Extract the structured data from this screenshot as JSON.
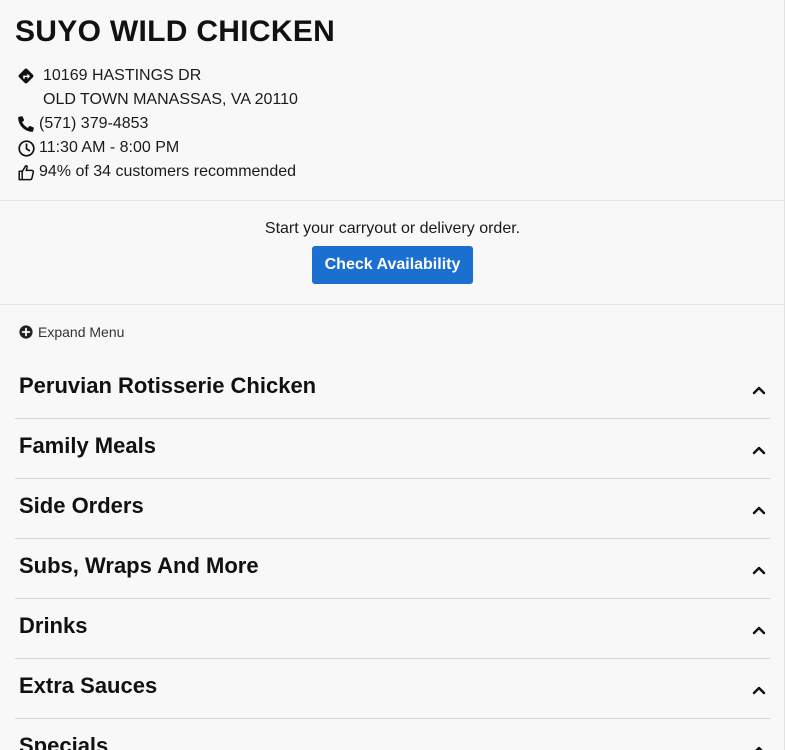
{
  "restaurant": {
    "name": "SUYO WILD CHICKEN",
    "address_line1": "10169 HASTINGS DR",
    "address_line2": "OLD TOWN MANASSAS, VA 20110",
    "phone": "(571) 379-4853",
    "hours": "11:30 AM - 8:00 PM",
    "recommendation": "94% of 34 customers recommended"
  },
  "icons": {
    "directions": "directions-icon",
    "phone": "phone-icon",
    "clock": "clock-icon",
    "thumbs_up": "thumbs-up-icon",
    "expand": "plus-circle-icon",
    "chevron": "chevron-up-icon"
  },
  "order": {
    "prompt": "Start your carryout or delivery order.",
    "button_label": "Check Availability"
  },
  "menu": {
    "expand_label": "Expand Menu",
    "sections": [
      {
        "title": "Peruvian Rotisserie Chicken"
      },
      {
        "title": "Family Meals"
      },
      {
        "title": "Side Orders"
      },
      {
        "title": "Subs, Wraps And More"
      },
      {
        "title": "Drinks"
      },
      {
        "title": "Extra Sauces"
      },
      {
        "title": "Specials"
      }
    ]
  },
  "colors": {
    "accent": "#1a6fd0",
    "background": "#f8f8f8",
    "text": "#111111",
    "divider": "#d6d6d6"
  }
}
